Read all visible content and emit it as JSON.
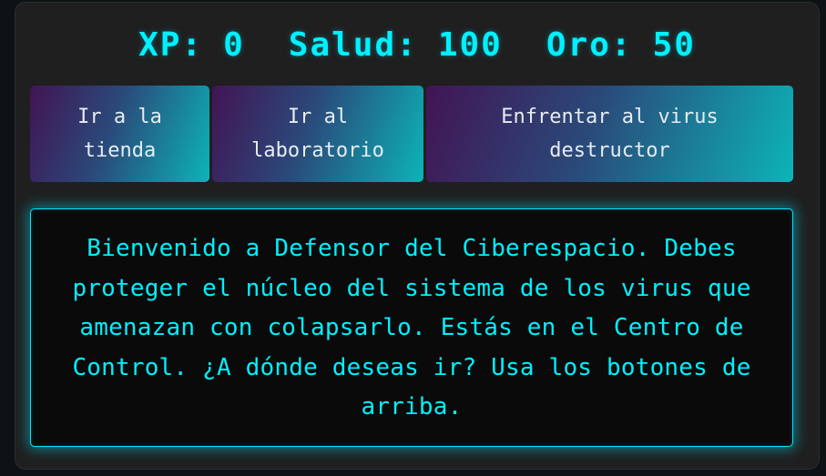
{
  "stats": {
    "xp_label": "XP:",
    "xp_value": "0",
    "health_label": "Salud:",
    "health_value": "100",
    "gold_label": "Oro:",
    "gold_value": "50"
  },
  "controls": {
    "store": "Ir a la tienda",
    "lab": "Ir al laboratorio",
    "fight": "Enfrentar al virus destructor"
  },
  "message": "Bienvenido a Defensor del Ciberespacio. Debes proteger el núcleo del sistema de los virus que amenazan con colapsarlo. Estás en el Centro de Control. ¿A dónde deseas ir? Usa los botones de arriba.",
  "colors": {
    "accent": "#00f0ff",
    "panel": "#1f1f1f",
    "page_background": "#0d1214",
    "button_gradient_start": "#421454",
    "button_gradient_end": "#0cb4b8"
  }
}
